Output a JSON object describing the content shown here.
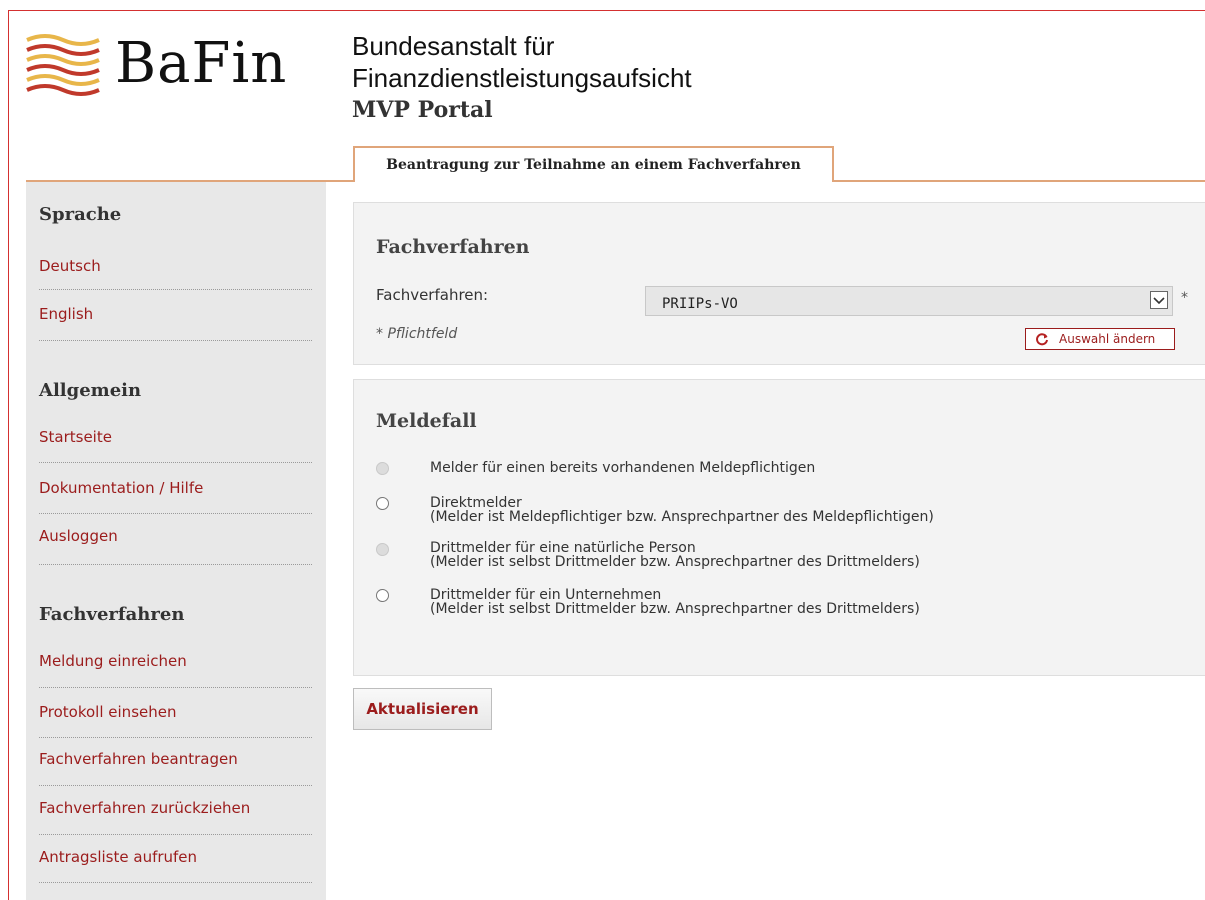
{
  "header": {
    "logo_text": "BaFin",
    "agency_line1": "Bundesanstalt für",
    "agency_line2": "Finanzdienstleistungsaufsicht",
    "portal": "MVP Portal",
    "tab": "Beantragung zur Teilnahme an einem Fachverfahren"
  },
  "sidebar": {
    "sections": [
      {
        "title": "Sprache",
        "items": [
          "Deutsch",
          "English"
        ]
      },
      {
        "title": "Allgemein",
        "items": [
          "Startseite",
          "Dokumentation / Hilfe",
          "Ausloggen"
        ]
      },
      {
        "title": "Fachverfahren",
        "items": [
          "Meldung einreichen",
          "Protokoll einsehen",
          "Fachverfahren beantragen",
          "Fachverfahren zurückziehen",
          "Antragsliste aufrufen"
        ]
      }
    ]
  },
  "fachverfahren_panel": {
    "title": "Fachverfahren",
    "field_label": "Fachverfahren:",
    "selected": "PRIIPs-VO",
    "required_mark": "*",
    "required_note": "* Pflichtfeld",
    "change_button": "Auswahl ändern"
  },
  "meldefall_panel": {
    "title": "Meldefall",
    "options": [
      {
        "line1": "Melder für einen bereits vorhandenen Meldepflichtigen",
        "line2": "",
        "enabled": false
      },
      {
        "line1": "Direktmelder",
        "line2": "(Melder ist Meldepflichtiger bzw. Ansprechpartner des Meldepflichtigen)",
        "enabled": true
      },
      {
        "line1": "Drittmelder für eine natürliche Person",
        "line2": "(Melder ist selbst Drittmelder bzw. Ansprechpartner des Drittmelders)",
        "enabled": false
      },
      {
        "line1": "Drittmelder für ein Unternehmen",
        "line2": "(Melder ist selbst Drittmelder bzw. Ansprechpartner des Drittmelders)",
        "enabled": true
      }
    ]
  },
  "update_button": "Aktualisieren",
  "colors": {
    "brand_red": "#9b1c1c",
    "tab_border": "#e0a57a",
    "sidebar_bg": "#e8e8e8"
  }
}
